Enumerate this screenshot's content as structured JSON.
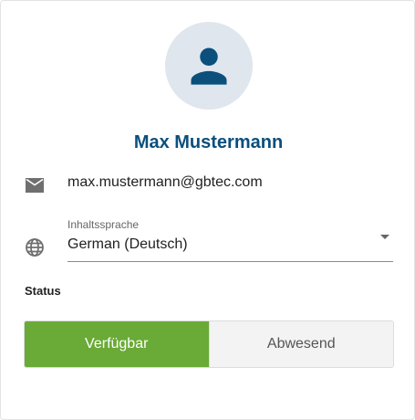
{
  "profile": {
    "name": "Max Mustermann",
    "avatar_icon": "person-icon",
    "avatar_bg": "#dfe6ee",
    "avatar_color": "#0b4f7c"
  },
  "contact": {
    "email_icon": "mail-icon",
    "email": "max.mustermann@gbtec.com"
  },
  "language": {
    "icon": "globe-icon",
    "label": "Inhaltssprache",
    "value": "German (Deutsch)"
  },
  "status": {
    "label": "Status",
    "options": [
      "Verfügbar",
      "Abwesend"
    ],
    "selected": "Verfügbar",
    "active_color": "#6aaa36"
  }
}
